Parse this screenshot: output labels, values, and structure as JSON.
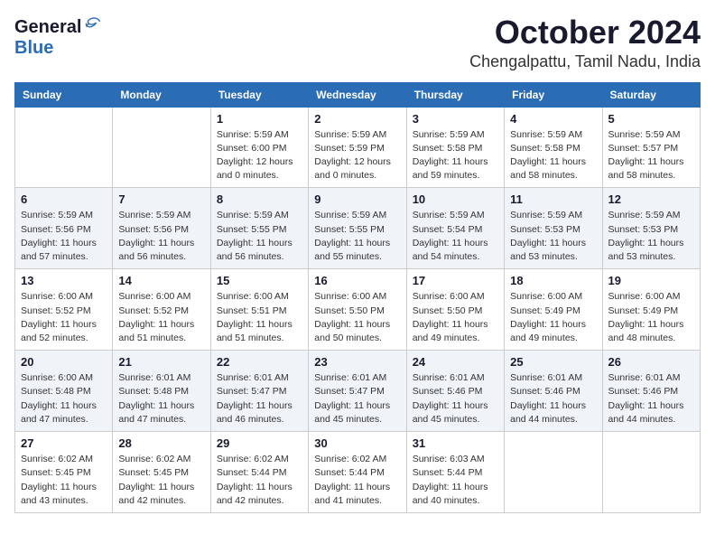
{
  "header": {
    "logo_general": "General",
    "logo_blue": "Blue",
    "month": "October 2024",
    "location": "Chengalpattu, Tamil Nadu, India"
  },
  "weekdays": [
    "Sunday",
    "Monday",
    "Tuesday",
    "Wednesday",
    "Thursday",
    "Friday",
    "Saturday"
  ],
  "weeks": [
    [
      {
        "day": "",
        "info": ""
      },
      {
        "day": "",
        "info": ""
      },
      {
        "day": "1",
        "info": "Sunrise: 5:59 AM\nSunset: 6:00 PM\nDaylight: 12 hours\nand 0 minutes."
      },
      {
        "day": "2",
        "info": "Sunrise: 5:59 AM\nSunset: 5:59 PM\nDaylight: 12 hours\nand 0 minutes."
      },
      {
        "day": "3",
        "info": "Sunrise: 5:59 AM\nSunset: 5:58 PM\nDaylight: 11 hours\nand 59 minutes."
      },
      {
        "day": "4",
        "info": "Sunrise: 5:59 AM\nSunset: 5:58 PM\nDaylight: 11 hours\nand 58 minutes."
      },
      {
        "day": "5",
        "info": "Sunrise: 5:59 AM\nSunset: 5:57 PM\nDaylight: 11 hours\nand 58 minutes."
      }
    ],
    [
      {
        "day": "6",
        "info": "Sunrise: 5:59 AM\nSunset: 5:56 PM\nDaylight: 11 hours\nand 57 minutes."
      },
      {
        "day": "7",
        "info": "Sunrise: 5:59 AM\nSunset: 5:56 PM\nDaylight: 11 hours\nand 56 minutes."
      },
      {
        "day": "8",
        "info": "Sunrise: 5:59 AM\nSunset: 5:55 PM\nDaylight: 11 hours\nand 56 minutes."
      },
      {
        "day": "9",
        "info": "Sunrise: 5:59 AM\nSunset: 5:55 PM\nDaylight: 11 hours\nand 55 minutes."
      },
      {
        "day": "10",
        "info": "Sunrise: 5:59 AM\nSunset: 5:54 PM\nDaylight: 11 hours\nand 54 minutes."
      },
      {
        "day": "11",
        "info": "Sunrise: 5:59 AM\nSunset: 5:53 PM\nDaylight: 11 hours\nand 53 minutes."
      },
      {
        "day": "12",
        "info": "Sunrise: 5:59 AM\nSunset: 5:53 PM\nDaylight: 11 hours\nand 53 minutes."
      }
    ],
    [
      {
        "day": "13",
        "info": "Sunrise: 6:00 AM\nSunset: 5:52 PM\nDaylight: 11 hours\nand 52 minutes."
      },
      {
        "day": "14",
        "info": "Sunrise: 6:00 AM\nSunset: 5:52 PM\nDaylight: 11 hours\nand 51 minutes."
      },
      {
        "day": "15",
        "info": "Sunrise: 6:00 AM\nSunset: 5:51 PM\nDaylight: 11 hours\nand 51 minutes."
      },
      {
        "day": "16",
        "info": "Sunrise: 6:00 AM\nSunset: 5:50 PM\nDaylight: 11 hours\nand 50 minutes."
      },
      {
        "day": "17",
        "info": "Sunrise: 6:00 AM\nSunset: 5:50 PM\nDaylight: 11 hours\nand 49 minutes."
      },
      {
        "day": "18",
        "info": "Sunrise: 6:00 AM\nSunset: 5:49 PM\nDaylight: 11 hours\nand 49 minutes."
      },
      {
        "day": "19",
        "info": "Sunrise: 6:00 AM\nSunset: 5:49 PM\nDaylight: 11 hours\nand 48 minutes."
      }
    ],
    [
      {
        "day": "20",
        "info": "Sunrise: 6:00 AM\nSunset: 5:48 PM\nDaylight: 11 hours\nand 47 minutes."
      },
      {
        "day": "21",
        "info": "Sunrise: 6:01 AM\nSunset: 5:48 PM\nDaylight: 11 hours\nand 47 minutes."
      },
      {
        "day": "22",
        "info": "Sunrise: 6:01 AM\nSunset: 5:47 PM\nDaylight: 11 hours\nand 46 minutes."
      },
      {
        "day": "23",
        "info": "Sunrise: 6:01 AM\nSunset: 5:47 PM\nDaylight: 11 hours\nand 45 minutes."
      },
      {
        "day": "24",
        "info": "Sunrise: 6:01 AM\nSunset: 5:46 PM\nDaylight: 11 hours\nand 45 minutes."
      },
      {
        "day": "25",
        "info": "Sunrise: 6:01 AM\nSunset: 5:46 PM\nDaylight: 11 hours\nand 44 minutes."
      },
      {
        "day": "26",
        "info": "Sunrise: 6:01 AM\nSunset: 5:46 PM\nDaylight: 11 hours\nand 44 minutes."
      }
    ],
    [
      {
        "day": "27",
        "info": "Sunrise: 6:02 AM\nSunset: 5:45 PM\nDaylight: 11 hours\nand 43 minutes."
      },
      {
        "day": "28",
        "info": "Sunrise: 6:02 AM\nSunset: 5:45 PM\nDaylight: 11 hours\nand 42 minutes."
      },
      {
        "day": "29",
        "info": "Sunrise: 6:02 AM\nSunset: 5:44 PM\nDaylight: 11 hours\nand 42 minutes."
      },
      {
        "day": "30",
        "info": "Sunrise: 6:02 AM\nSunset: 5:44 PM\nDaylight: 11 hours\nand 41 minutes."
      },
      {
        "day": "31",
        "info": "Sunrise: 6:03 AM\nSunset: 5:44 PM\nDaylight: 11 hours\nand 40 minutes."
      },
      {
        "day": "",
        "info": ""
      },
      {
        "day": "",
        "info": ""
      }
    ]
  ]
}
